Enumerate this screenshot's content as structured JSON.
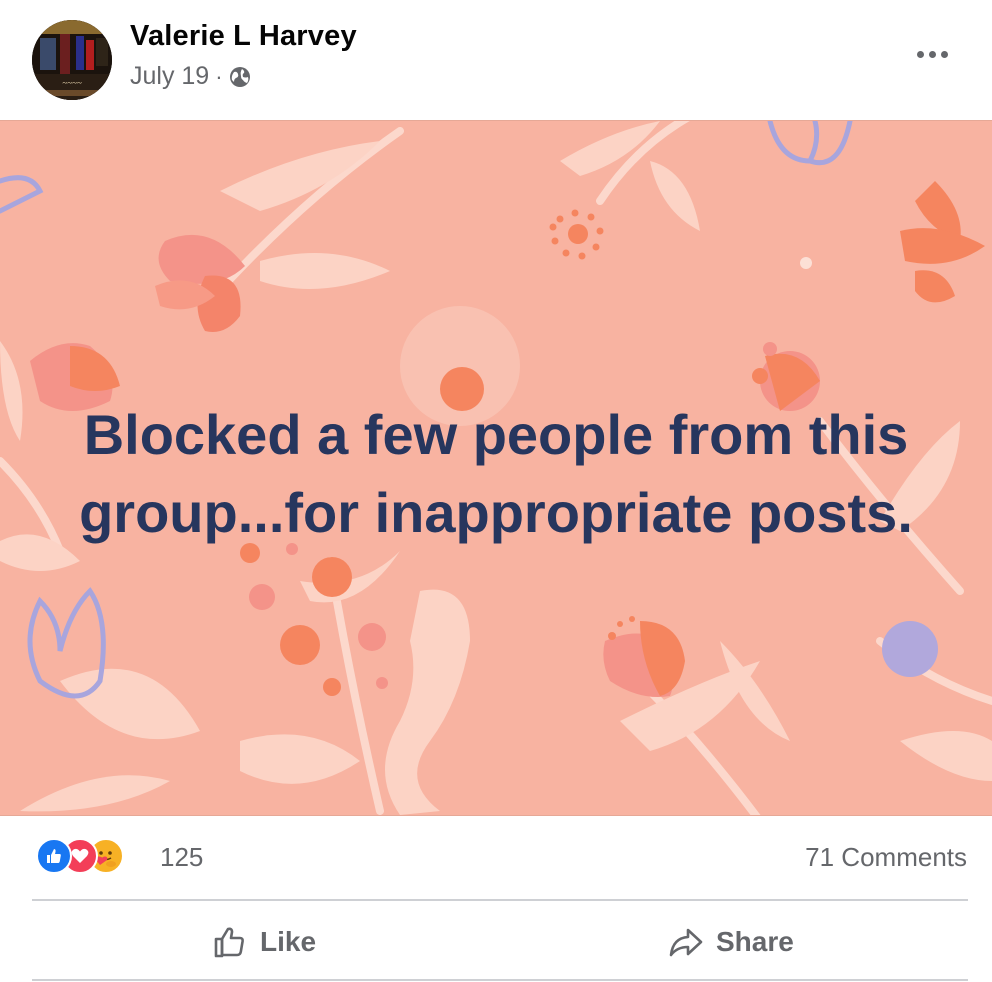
{
  "post": {
    "author": "Valerie L Harvey",
    "date": "July 19",
    "separator": "·",
    "privacy_icon": "globe-icon",
    "more_icon": "more-horizontal-icon",
    "text_line1": "Blocked a few people from this",
    "text_line2": "group...for inappropriate posts.",
    "background_color": "#f8b3a1",
    "text_color": "#27365e"
  },
  "stats": {
    "reaction_icons": [
      "like-reaction-icon",
      "love-reaction-icon",
      "care-reaction-icon"
    ],
    "reaction_count": "125",
    "comments": "71 Comments"
  },
  "actions": {
    "like": "Like",
    "share": "Share"
  }
}
